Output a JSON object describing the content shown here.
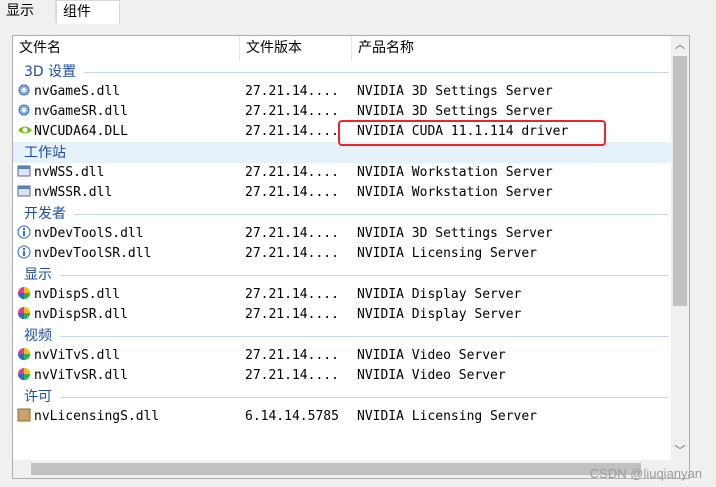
{
  "tabs": [
    "显示",
    "组件"
  ],
  "columns": [
    "文件名",
    "文件版本",
    "产品名称"
  ],
  "groups": {
    "g1": "3D 设置",
    "g2": "工作站",
    "g3": "开发者",
    "g4": "显示",
    "g5": "视频",
    "g6": "许可"
  },
  "rows": {
    "r1": [
      "nvGameS.dll",
      "27.21.14....",
      "NVIDIA 3D Settings Server"
    ],
    "r2": [
      "nvGameSR.dll",
      "27.21.14....",
      "NVIDIA 3D Settings Server"
    ],
    "r3": [
      "NVCUDA64.DLL",
      "27.21.14....",
      "NVIDIA CUDA 11.1.114 driver"
    ],
    "r4": [
      "nvWSS.dll",
      "27.21.14....",
      "NVIDIA Workstation Server"
    ],
    "r5": [
      "nvWSSR.dll",
      "27.21.14....",
      "NVIDIA Workstation Server"
    ],
    "r6": [
      "nvDevToolS.dll",
      "27.21.14....",
      "NVIDIA 3D Settings Server"
    ],
    "r7": [
      "nvDevToolSR.dll",
      "27.21.14....",
      "NVIDIA Licensing Server"
    ],
    "r8": [
      "nvDispS.dll",
      "27.21.14....",
      "NVIDIA Display Server"
    ],
    "r9": [
      "nvDispSR.dll",
      "27.21.14....",
      "NVIDIA Display Server"
    ],
    "r10": [
      "nvViTvS.dll",
      "27.21.14....",
      "NVIDIA Video Server"
    ],
    "r11": [
      "nvViTvSR.dll",
      "27.21.14....",
      "NVIDIA Video Server"
    ],
    "r12": [
      "nvLicensingS.dll",
      "6.14.14.5785",
      "NVIDIA Licensing Server"
    ]
  },
  "watermark": "CSDN @liuqianyan",
  "icons": {
    "gear": "settings-gear-icon",
    "nvidia": "nvidia-eye-icon",
    "workstation": "workstation-window-icon",
    "info": "info-icon",
    "color": "color-wheel-icon",
    "license": "license-icon"
  }
}
